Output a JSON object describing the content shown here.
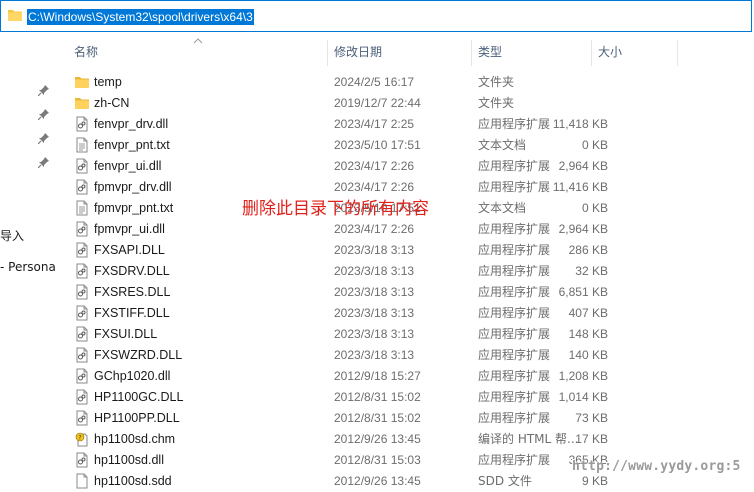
{
  "address_bar": {
    "path": "C:\\Windows\\System32\\spool\\drivers\\x64\\3"
  },
  "nav": {
    "items": [
      "导入",
      "- Persona"
    ]
  },
  "columns": {
    "name": "名称",
    "date": "修改日期",
    "type": "类型",
    "size": "大小"
  },
  "files": [
    {
      "icon": "folder-icon",
      "name": "temp",
      "date": "2024/2/5 16:17",
      "type": "文件夹",
      "size": ""
    },
    {
      "icon": "folder-icon",
      "name": "zh-CN",
      "date": "2019/12/7 22:44",
      "type": "文件夹",
      "size": ""
    },
    {
      "icon": "dll-file-icon",
      "name": "fenvpr_drv.dll",
      "date": "2023/4/17 2:25",
      "type": "应用程序扩展",
      "size": "11,418 KB"
    },
    {
      "icon": "txt-file-icon",
      "name": "fenvpr_pnt.txt",
      "date": "2023/5/10 17:51",
      "type": "文本文档",
      "size": "0 KB"
    },
    {
      "icon": "dll-file-icon",
      "name": "fenvpr_ui.dll",
      "date": "2023/4/17 2:26",
      "type": "应用程序扩展",
      "size": "2,964 KB"
    },
    {
      "icon": "dll-file-icon",
      "name": "fpmvpr_drv.dll",
      "date": "2023/4/17 2:26",
      "type": "应用程序扩展",
      "size": "11,416 KB"
    },
    {
      "icon": "txt-file-icon",
      "name": "fpmvpr_pnt.txt",
      "date": "2023/5/10 17:51",
      "type": "文本文档",
      "size": "0 KB"
    },
    {
      "icon": "dll-file-icon",
      "name": "fpmvpr_ui.dll",
      "date": "2023/4/17 2:26",
      "type": "应用程序扩展",
      "size": "2,964 KB"
    },
    {
      "icon": "dll-file-icon",
      "name": "FXSAPI.DLL",
      "date": "2023/3/18 3:13",
      "type": "应用程序扩展",
      "size": "286 KB"
    },
    {
      "icon": "dll-file-icon",
      "name": "FXSDRV.DLL",
      "date": "2023/3/18 3:13",
      "type": "应用程序扩展",
      "size": "32 KB"
    },
    {
      "icon": "dll-file-icon",
      "name": "FXSRES.DLL",
      "date": "2023/3/18 3:13",
      "type": "应用程序扩展",
      "size": "6,851 KB"
    },
    {
      "icon": "dll-file-icon",
      "name": "FXSTIFF.DLL",
      "date": "2023/3/18 3:13",
      "type": "应用程序扩展",
      "size": "407 KB"
    },
    {
      "icon": "dll-file-icon",
      "name": "FXSUI.DLL",
      "date": "2023/3/18 3:13",
      "type": "应用程序扩展",
      "size": "148 KB"
    },
    {
      "icon": "dll-file-icon",
      "name": "FXSWZRD.DLL",
      "date": "2023/3/18 3:13",
      "type": "应用程序扩展",
      "size": "140 KB"
    },
    {
      "icon": "dll-file-icon",
      "name": "GChp1020.dll",
      "date": "2012/9/18 15:27",
      "type": "应用程序扩展",
      "size": "1,208 KB"
    },
    {
      "icon": "dll-file-icon",
      "name": "HP1100GC.DLL",
      "date": "2012/8/31 15:02",
      "type": "应用程序扩展",
      "size": "1,014 KB"
    },
    {
      "icon": "dll-file-icon",
      "name": "HP1100PP.DLL",
      "date": "2012/8/31 15:02",
      "type": "应用程序扩展",
      "size": "73 KB"
    },
    {
      "icon": "chm-file-icon",
      "name": "hp1100sd.chm",
      "date": "2012/9/26 13:45",
      "type": "编译的 HTML 帮...",
      "size": "17 KB"
    },
    {
      "icon": "dll-file-icon",
      "name": "hp1100sd.dll",
      "date": "2012/8/31 15:03",
      "type": "应用程序扩展",
      "size": "365 KB"
    },
    {
      "icon": "sdd-file-icon",
      "name": "hp1100sd.sdd",
      "date": "2012/9/26 13:45",
      "type": "SDD 文件",
      "size": "9 KB"
    }
  ],
  "annotation": {
    "text": "删除此目录下的所有内容",
    "color": "#e0201b"
  },
  "watermark": {
    "text": "http://www.yydy.org:5"
  },
  "colors": {
    "accent": "#0078d7",
    "folder": "#f5c84c",
    "header_text": "#4c607a",
    "meta_text": "#6d6d6d"
  }
}
